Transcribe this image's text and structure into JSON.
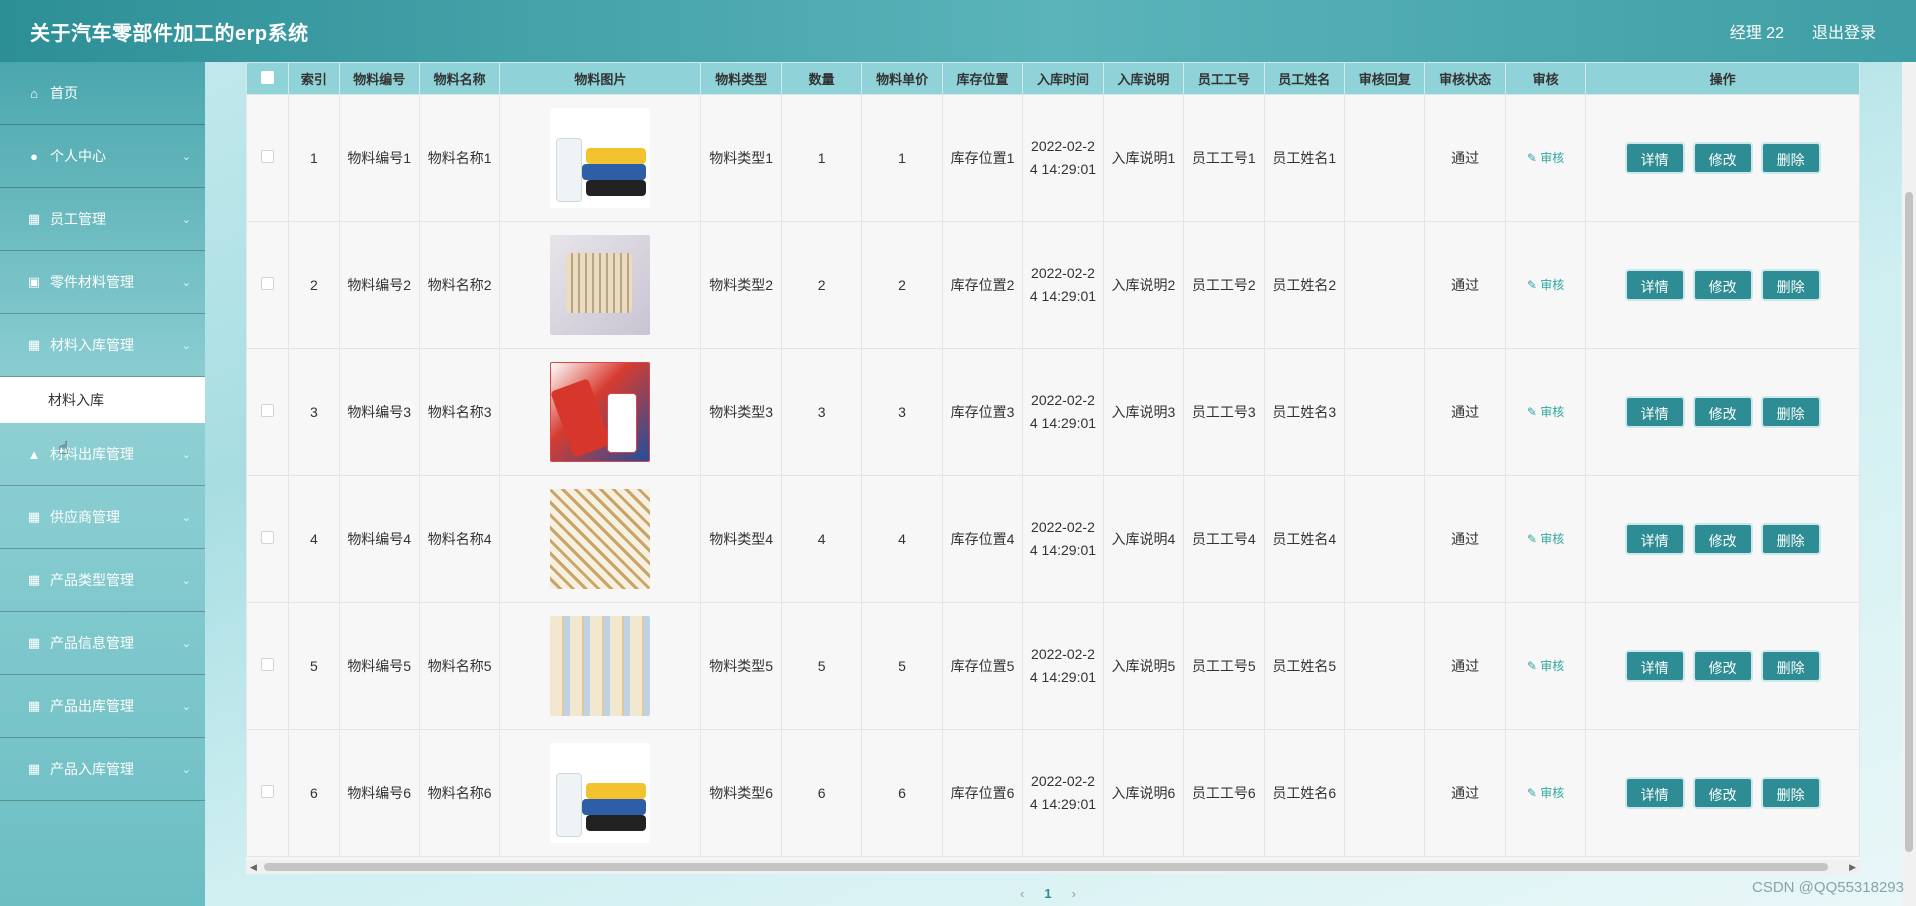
{
  "header": {
    "app_title": "关于汽车零部件加工的erp系统",
    "user": "经理 22",
    "logout": "退出登录"
  },
  "sidebar": {
    "items": [
      {
        "label": "首页",
        "icon": "home-icon",
        "chevron": false
      },
      {
        "label": "个人中心",
        "icon": "user-icon",
        "chevron": true
      },
      {
        "label": "员工管理",
        "icon": "grid-icon",
        "chevron": true
      },
      {
        "label": "零件材料管理",
        "icon": "clipboard-icon",
        "chevron": true
      },
      {
        "label": "材料入库管理",
        "icon": "grid-icon",
        "chevron": true
      }
    ],
    "active_sub": "材料入库",
    "items_after": [
      {
        "label": "材料出库管理",
        "icon": "thumb-icon",
        "chevron": true
      },
      {
        "label": "供应商管理",
        "icon": "grid-icon",
        "chevron": true
      },
      {
        "label": "产品类型管理",
        "icon": "grid-icon",
        "chevron": true
      },
      {
        "label": "产品信息管理",
        "icon": "grid-icon",
        "chevron": true
      },
      {
        "label": "产品出库管理",
        "icon": "grid-icon",
        "chevron": true
      },
      {
        "label": "产品入库管理",
        "icon": "grid-icon",
        "chevron": true
      }
    ]
  },
  "table": {
    "columns": [
      "索引",
      "物料编号",
      "物料名称",
      "物料图片",
      "物料类型",
      "数量",
      "物料单价",
      "库存位置",
      "入库时间",
      "入库说明",
      "员工工号",
      "员工姓名",
      "审核回复",
      "审核状态",
      "审核",
      "操作"
    ],
    "rows": [
      {
        "index": "1",
        "code": "物料编号1",
        "name": "物料名称1",
        "image": "trash-bags-image",
        "type": "物料类型1",
        "qty": "1",
        "price": "1",
        "location": "库存位置1",
        "time": "2022-02-24 14:29:01",
        "note": "入库说明1",
        "emp_no": "员工工号1",
        "emp_name": "员工姓名1",
        "reply": "",
        "status": "通过",
        "audit": "审核"
      },
      {
        "index": "2",
        "code": "物料编号2",
        "name": "物料名称2",
        "image": "toothbrush-pack-image",
        "type": "物料类型2",
        "qty": "2",
        "price": "2",
        "location": "库存位置2",
        "time": "2022-02-24 14:29:01",
        "note": "入库说明2",
        "emp_no": "员工工号2",
        "emp_name": "员工姓名2",
        "reply": "",
        "status": "通过",
        "audit": "审核"
      },
      {
        "index": "3",
        "code": "物料编号3",
        "name": "物料名称3",
        "image": "toothpaste-image",
        "type": "物料类型3",
        "qty": "3",
        "price": "3",
        "location": "库存位置3",
        "time": "2022-02-24 14:29:01",
        "note": "入库说明3",
        "emp_no": "员工工号3",
        "emp_name": "员工姓名3",
        "reply": "",
        "status": "通过",
        "audit": "审核"
      },
      {
        "index": "4",
        "code": "物料编号4",
        "name": "物料名称4",
        "image": "cotton-swabs-image",
        "type": "物料类型4",
        "qty": "4",
        "price": "4",
        "location": "库存位置4",
        "time": "2022-02-24 14:29:01",
        "note": "入库说明4",
        "emp_no": "员工工号4",
        "emp_name": "员工姓名4",
        "reply": "",
        "status": "通过",
        "audit": "审核"
      },
      {
        "index": "5",
        "code": "物料编号5",
        "name": "物料名称5",
        "image": "tissue-rolls-image",
        "type": "物料类型5",
        "qty": "5",
        "price": "5",
        "location": "库存位置5",
        "time": "2022-02-24 14:29:01",
        "note": "入库说明5",
        "emp_no": "员工工号5",
        "emp_name": "员工姓名5",
        "reply": "",
        "status": "通过",
        "audit": "审核"
      },
      {
        "index": "6",
        "code": "物料编号6",
        "name": "物料名称6",
        "image": "trash-bags-image",
        "type": "物料类型6",
        "qty": "6",
        "price": "6",
        "location": "库存位置6",
        "time": "2022-02-24 14:29:01",
        "note": "入库说明6",
        "emp_no": "员工工号6",
        "emp_name": "员工姓名6",
        "reply": "",
        "status": "通过",
        "audit": "审核"
      }
    ],
    "actions": {
      "detail": "详情",
      "edit": "修改",
      "delete": "删除"
    }
  },
  "pagination": {
    "prev": "‹",
    "current": "1",
    "next": "›"
  },
  "watermark": "CSDN @QQ55318293",
  "colors": {
    "primary": "#2e8d94",
    "header_bg": "#4ea9af",
    "table_header": "#8fd3d8"
  }
}
